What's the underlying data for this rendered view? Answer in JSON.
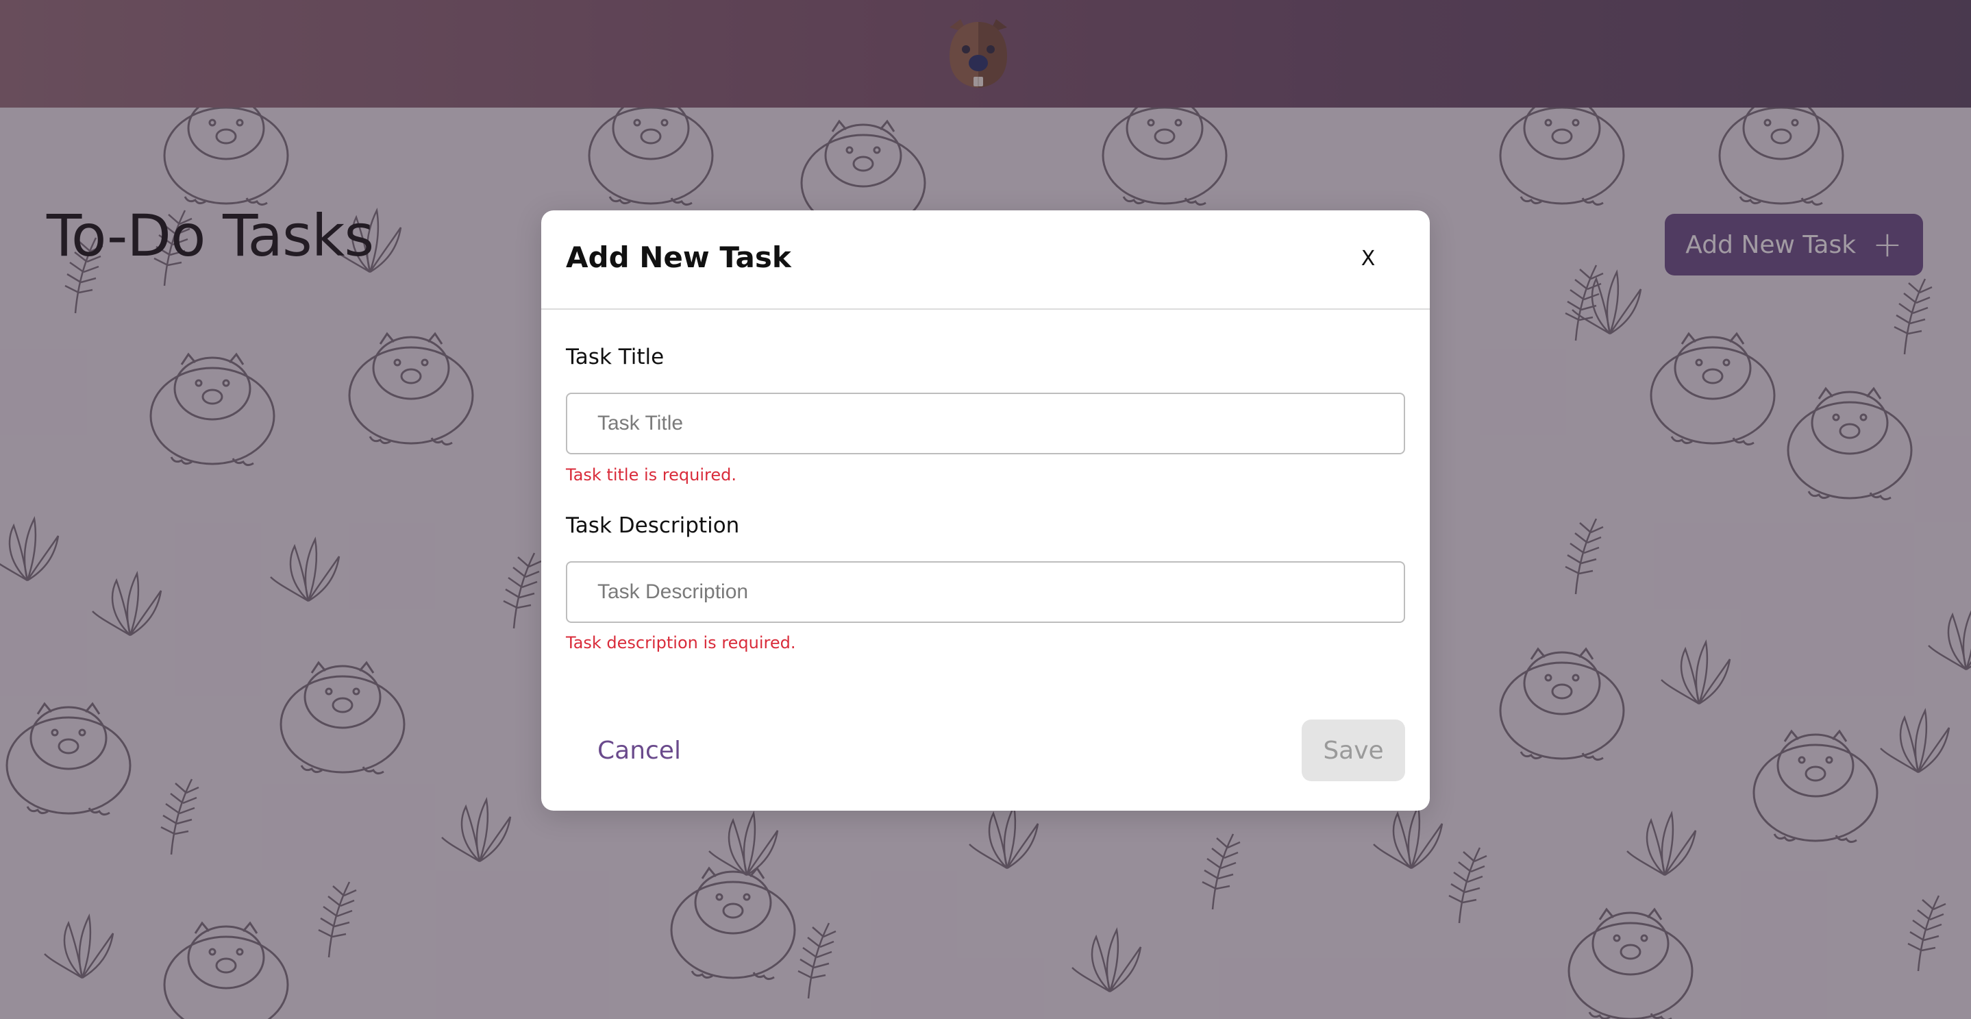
{
  "header": {
    "logo_icon": "wombat-face-icon"
  },
  "page": {
    "title": "To-Do Tasks",
    "add_task_label": "Add New Task",
    "add_icon": "plus-icon"
  },
  "modal": {
    "title": "Add New Task",
    "close_label": "X",
    "fields": [
      {
        "label": "Task Title",
        "value": "",
        "placeholder": "Task Title",
        "error": "Task title is required."
      },
      {
        "label": "Task Description",
        "value": "",
        "placeholder": "Task Description",
        "error": "Task description is required."
      }
    ],
    "cancel_label": "Cancel",
    "save_label": "Save"
  },
  "colors": {
    "header_gradient_start": "#8a636f",
    "header_gradient_end": "#4d3a55",
    "primary_button": "#5b3f7a",
    "error_text": "#d92b3a",
    "cancel_text": "#6a4a8c",
    "save_disabled_bg": "#e4e4e4"
  }
}
